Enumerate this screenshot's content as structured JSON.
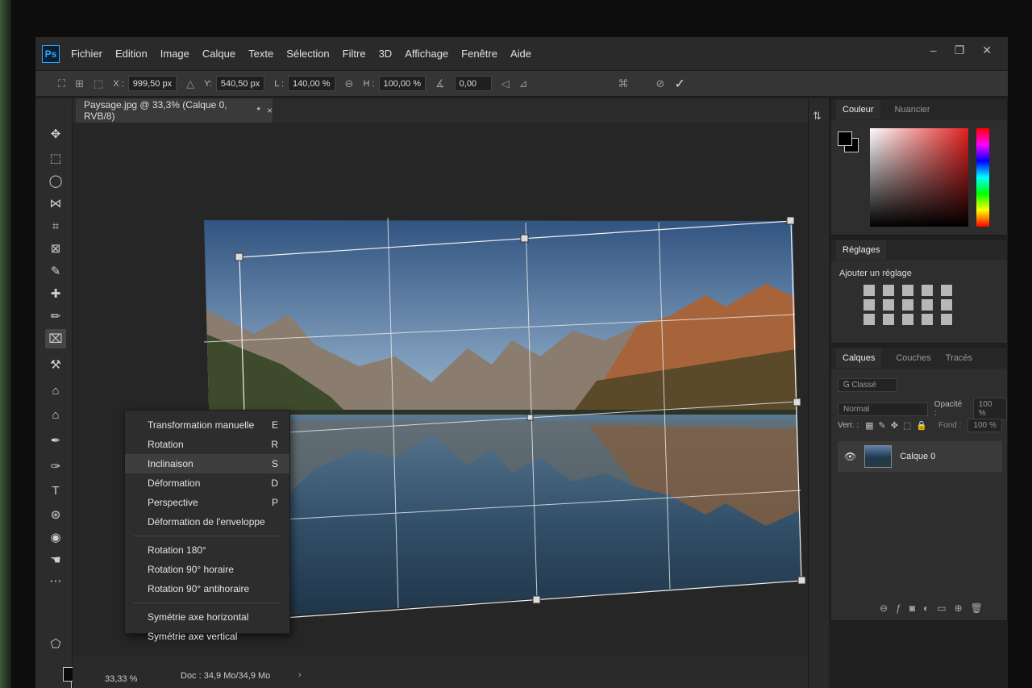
{
  "app": {
    "logo": "Ps",
    "menu": [
      "Fichier",
      "Edition",
      "Image",
      "Calque",
      "Texte",
      "Sélection",
      "Filtre",
      "3D",
      "Affichage",
      "Fenêtre",
      "Aide"
    ]
  },
  "options": {
    "x_label": "X :",
    "x_value": "999,50 px",
    "y_label": "Y:",
    "y_value": "540,50 px",
    "l_label": "L :",
    "l_value": "140,00 %",
    "h_label": "H :",
    "h_value": "100,00 %",
    "angle_value": "0,00"
  },
  "document": {
    "tab_title": "Paysage.jpg @ 33,3% (Calque 0, RVB/8)",
    "tab_suffix": "*",
    "tab_close": "×"
  },
  "status": {
    "zoom": "33,33 %",
    "doc": "Doc : 34,9 Mo/34,9 Mo",
    "arrow": "›"
  },
  "context_menu": {
    "group1": [
      {
        "label": "Transformation manuelle",
        "key": "E"
      },
      {
        "label": "Rotation",
        "key": "R"
      },
      {
        "label": "Inclinaison",
        "key": "S"
      },
      {
        "label": "Déformation",
        "key": "D"
      },
      {
        "label": "Perspective",
        "key": "P"
      },
      {
        "label": "Déformation de l'enveloppe",
        "key": ""
      }
    ],
    "group2": [
      {
        "label": "Rotation 180°",
        "key": ""
      },
      {
        "label": "Rotation 90° horaire",
        "key": ""
      },
      {
        "label": "Rotation 90° antihoraire",
        "key": ""
      }
    ],
    "group3": [
      {
        "label": "Symétrie axe horizontal",
        "key": ""
      },
      {
        "label": "Symétrie axe vertical",
        "key": ""
      }
    ],
    "hovered_index": 2
  },
  "color_panel": {
    "tab_active": "Couleur",
    "tab_other": "Nuancier"
  },
  "adjustments_panel": {
    "tab": "Réglages",
    "title": "Ajouter un réglage"
  },
  "layers_panel": {
    "tab_active": "Calques",
    "tab_couches": "Couches",
    "tab_traces": "Tracés",
    "filter": "Ꮐ Classé",
    "blend_mode": "Normal",
    "opacity_label": "Opacité :",
    "opacity_value": "100 %",
    "lock_label": "Verr. :",
    "fill_label": "Fond :",
    "fill_value": "100 %",
    "layer_name": "Calque 0"
  },
  "colors": {
    "accent": "#31a8ff",
    "panel_bg": "#2e2e2e",
    "menu_bg": "#2a2a2a"
  }
}
